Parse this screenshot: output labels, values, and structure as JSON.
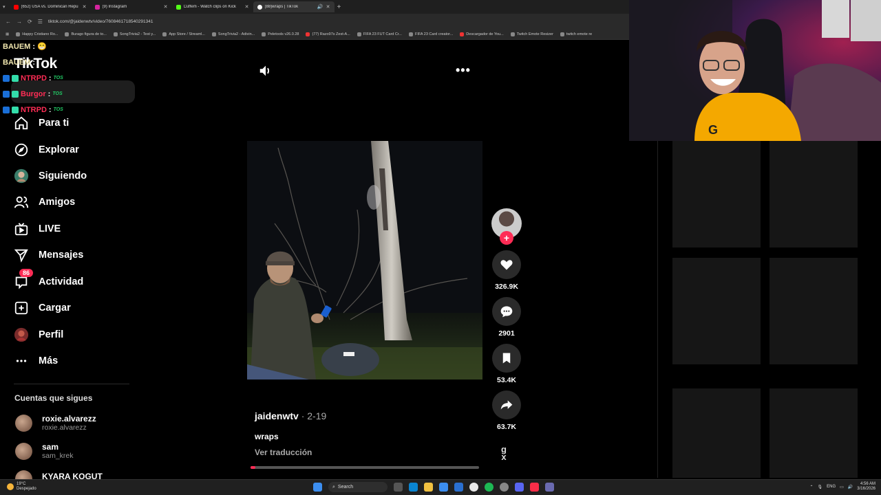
{
  "browser": {
    "tabs": [
      {
        "title": "(652) USA vs. Dominican Repu",
        "color": "#ff0000"
      },
      {
        "title": "(9) Instagram",
        "color": "#d6249f"
      },
      {
        "title": "Cuffem - Watch clips on Kick",
        "color": "#53fc18"
      },
      {
        "title": "(88)wraps | TikTok",
        "color": "#ffffff",
        "active": true
      }
    ],
    "address": "tiktok.com/@jaidenwtv/video/7608461718540291341",
    "bookmarks": [
      "Happy Cristiano Ro...",
      "Burago figura de to...",
      "SongTrivia2 - Test y...",
      "App Store / Streaml...",
      "SongTrivia2 - Adivin...",
      "Peletools v26.0.28",
      "(77) Razo97s Zest-A...",
      "FIFA 23 FUT Card Cr...",
      "FIFA 23 Card creator...",
      "Descargador de You...",
      "Twitch Emote Resizer",
      "twitch emote re"
    ]
  },
  "chat": {
    "lines": [
      {
        "user": "BAUEM",
        "sep": ":"
      },
      {
        "user": "BAUEM",
        "sep": ":"
      },
      {
        "user": "NTRPD",
        "sep": ":"
      },
      {
        "user": "Burgor",
        "sep": ":"
      },
      {
        "user": "NTRPD",
        "sep": ":"
      }
    ],
    "emote": "TOS"
  },
  "sidebar": {
    "logo": "TikTok",
    "nav": [
      {
        "label": "Para ti",
        "icon": "home-icon"
      },
      {
        "label": "Explorar",
        "icon": "compass-icon"
      },
      {
        "label": "Siguiendo",
        "icon": "following-avatar-icon"
      },
      {
        "label": "Amigos",
        "icon": "friends-icon"
      },
      {
        "label": "LIVE",
        "icon": "live-tv-icon"
      },
      {
        "label": "Mensajes",
        "icon": "send-icon"
      },
      {
        "label": "Actividad",
        "icon": "inbox-icon",
        "badge": "86"
      },
      {
        "label": "Cargar",
        "icon": "upload-plus-icon"
      },
      {
        "label": "Perfil",
        "icon": "profile-avatar-icon"
      },
      {
        "label": "Más",
        "icon": "more-dots-icon"
      }
    ],
    "following_title": "Cuentas que sigues",
    "accounts": [
      {
        "name": "roxie.alvarezz",
        "handle": "roxie.alvarezz"
      },
      {
        "name": "sam",
        "handle": "sam_krek"
      },
      {
        "name": "KYARA KOGUT",
        "handle": ""
      }
    ]
  },
  "video": {
    "author": "jaidenwtv",
    "date": "2-19",
    "caption": "wraps",
    "translate": "Ver traducción",
    "progress": 0.0
  },
  "actions": {
    "likes": "326.9K",
    "comments": "2901",
    "saves": "53.4K",
    "shares": "63.7K"
  },
  "taskbar": {
    "temp": "19°C",
    "weather": "Despejado",
    "search": "Search",
    "lang": "ENG",
    "time": "4:56 AM",
    "date": "3/16/2026"
  },
  "colors": {
    "accent": "#fe2c55",
    "bg": "#000000"
  }
}
